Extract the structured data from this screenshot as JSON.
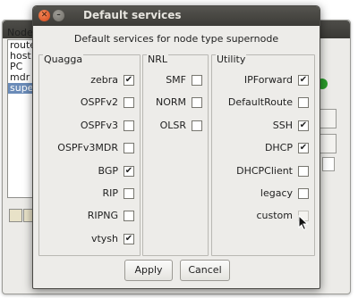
{
  "background_window": {
    "nodes_label": "Node",
    "node_list": [
      "router",
      "host",
      "PC",
      "mdr",
      "supernode"
    ],
    "selected_index": 4
  },
  "dialog": {
    "title": "Default services",
    "heading": "Default services for node type supernode",
    "groups": [
      {
        "title": "Quagga",
        "services": [
          {
            "label": "zebra",
            "checked": true
          },
          {
            "label": "OSPFv2",
            "checked": false
          },
          {
            "label": "OSPFv3",
            "checked": false
          },
          {
            "label": "OSPFv3MDR",
            "checked": false
          },
          {
            "label": "BGP",
            "checked": true
          },
          {
            "label": "RIP",
            "checked": false
          },
          {
            "label": "RIPNG",
            "checked": false
          },
          {
            "label": "vtysh",
            "checked": true
          }
        ]
      },
      {
        "title": "NRL",
        "services": [
          {
            "label": "SMF",
            "checked": false
          },
          {
            "label": "NORM",
            "checked": false
          },
          {
            "label": "OLSR",
            "checked": false
          }
        ]
      },
      {
        "title": "Utility",
        "services": [
          {
            "label": "IPForward",
            "checked": true
          },
          {
            "label": "DefaultRoute",
            "checked": false
          },
          {
            "label": "SSH",
            "checked": true
          },
          {
            "label": "DHCP",
            "checked": true
          },
          {
            "label": "DHCPClient",
            "checked": false
          },
          {
            "label": "legacy",
            "checked": false
          },
          {
            "label": "custom",
            "checked": false
          }
        ]
      }
    ],
    "apply_label": "Apply",
    "cancel_label": "Cancel",
    "check_glyph": "✔"
  }
}
